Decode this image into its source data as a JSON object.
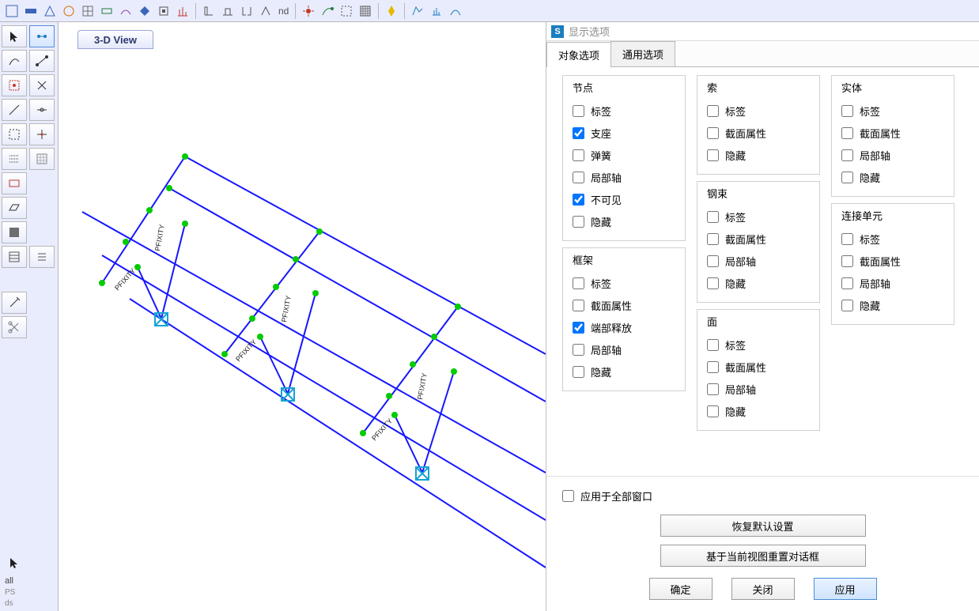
{
  "toolbar_text": "nd",
  "view_tab": "3-D View",
  "left_label": "all",
  "dialog": {
    "title_icon": "S",
    "title": "显示选项",
    "tabs": {
      "object": "对象选项",
      "general": "通用选项"
    },
    "groups": {
      "joint": {
        "title": "节点",
        "items": [
          {
            "label": "标签",
            "checked": false
          },
          {
            "label": "支座",
            "checked": true
          },
          {
            "label": "弹簧",
            "checked": false
          },
          {
            "label": "局部轴",
            "checked": false
          },
          {
            "label": "不可见",
            "checked": true
          },
          {
            "label": "隐藏",
            "checked": false
          }
        ]
      },
      "frame": {
        "title": "框架",
        "items": [
          {
            "label": "标签",
            "checked": false
          },
          {
            "label": "截面属性",
            "checked": false
          },
          {
            "label": "端部释放",
            "checked": true
          },
          {
            "label": "局部轴",
            "checked": false
          },
          {
            "label": "隐藏",
            "checked": false
          }
        ]
      },
      "cable": {
        "title": "索",
        "items": [
          {
            "label": "标签",
            "checked": false
          },
          {
            "label": "截面属性",
            "checked": false
          },
          {
            "label": "隐藏",
            "checked": false
          }
        ]
      },
      "tendon": {
        "title": "钢束",
        "items": [
          {
            "label": "标签",
            "checked": false
          },
          {
            "label": "截面属性",
            "checked": false
          },
          {
            "label": "局部轴",
            "checked": false
          },
          {
            "label": "隐藏",
            "checked": false
          }
        ]
      },
      "area": {
        "title": "面",
        "items": [
          {
            "label": "标签",
            "checked": false
          },
          {
            "label": "截面属性",
            "checked": false
          },
          {
            "label": "局部轴",
            "checked": false
          },
          {
            "label": "隐藏",
            "checked": false
          }
        ]
      },
      "solid": {
        "title": "实体",
        "items": [
          {
            "label": "标签",
            "checked": false
          },
          {
            "label": "截面属性",
            "checked": false
          },
          {
            "label": "局部轴",
            "checked": false
          },
          {
            "label": "隐藏",
            "checked": false
          }
        ]
      },
      "link": {
        "title": "连接单元",
        "items": [
          {
            "label": "标签",
            "checked": false
          },
          {
            "label": "截面属性",
            "checked": false
          },
          {
            "label": "局部轴",
            "checked": false
          },
          {
            "label": "隐藏",
            "checked": false
          }
        ]
      }
    },
    "apply_all": "应用于全部窗口",
    "restore_defaults": "恢复默认设置",
    "reset_from_view": "基于当前视图重置对话框",
    "ok": "确定",
    "close": "关闭",
    "apply": "应用"
  },
  "canvas_labels": {
    "pfixity": "PFIXITY"
  }
}
